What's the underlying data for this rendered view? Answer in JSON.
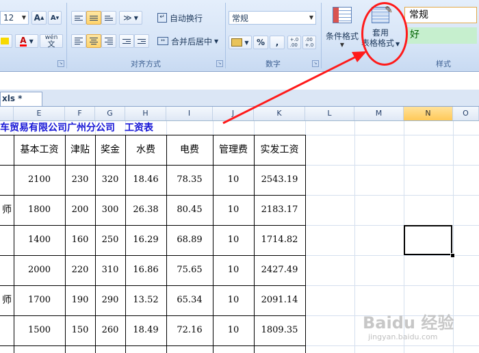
{
  "ribbon": {
    "font_size": "12",
    "font_grow": "A",
    "font_shrink": "A",
    "font_color_letter": "A",
    "wen_button": "wén",
    "alignment": {
      "wrap_text": "自动换行",
      "merge_center": "合并后居中",
      "group_label": "对齐方式"
    },
    "number": {
      "format_value": "常规",
      "percent": "%",
      "comma": ",",
      "inc_decimal": "+.0\n.00",
      "dec_decimal": ".00\n+.0",
      "group_label": "数字"
    },
    "styles": {
      "conditional_format": "条件格式",
      "format_as_table_line1": "套用",
      "format_as_table_line2": "表格格式",
      "style_normal": "常规",
      "style_good": "好",
      "group_label": "样式",
      "good_bg": "#c6efce",
      "good_text": "#006100"
    }
  },
  "workbook_tab": "xls *",
  "columns": [
    "E",
    "F",
    "G",
    "H",
    "I",
    "J",
    "K",
    "L",
    "M",
    "N",
    "O"
  ],
  "selected_column": "N",
  "sheet": {
    "title": "车贸易有限公司广州分公司　工资表",
    "headers": [
      "基本工资",
      "津贴",
      "奖金",
      "水费",
      "电费",
      "管理费",
      "实发工资"
    ],
    "row_prefix": [
      "",
      "师",
      "",
      "",
      "师",
      ""
    ],
    "rows": [
      [
        "2100",
        "230",
        "320",
        "18.46",
        "78.35",
        "10",
        "2543.19"
      ],
      [
        "1800",
        "200",
        "300",
        "26.38",
        "80.45",
        "10",
        "2183.17"
      ],
      [
        "1400",
        "160",
        "250",
        "16.29",
        "68.89",
        "10",
        "1714.82"
      ],
      [
        "2000",
        "220",
        "310",
        "16.86",
        "75.65",
        "10",
        "2427.49"
      ],
      [
        "1700",
        "190",
        "290",
        "13.52",
        "65.34",
        "10",
        "2091.14"
      ],
      [
        "1500",
        "150",
        "260",
        "18.49",
        "72.16",
        "10",
        "1809.35"
      ]
    ]
  },
  "watermark": {
    "brand": "Baidu 经验",
    "url": "jingyan.baidu.com"
  },
  "colors": {
    "title_blue": "#1515d6",
    "callout_red": "#ff1a1a",
    "selected_col_header": "#ffc958"
  }
}
